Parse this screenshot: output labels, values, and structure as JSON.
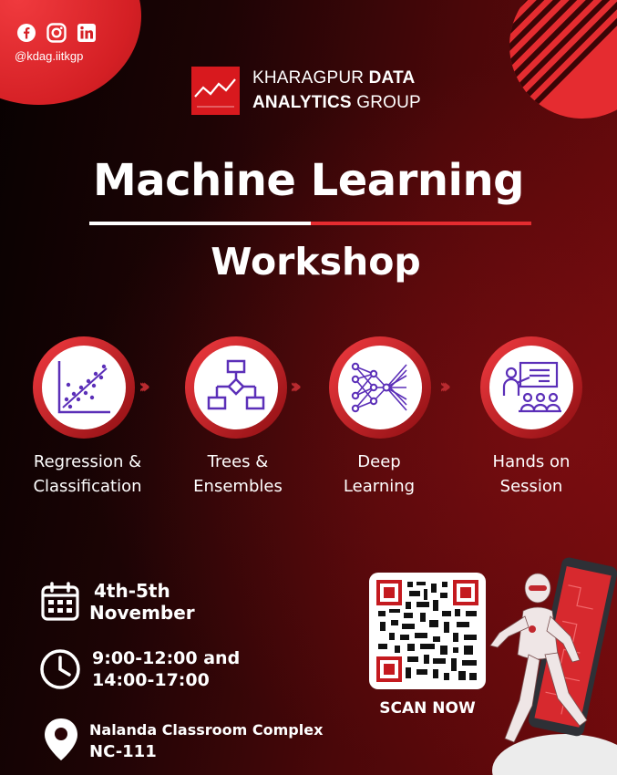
{
  "social": {
    "icons": [
      "facebook-icon",
      "instagram-icon",
      "linkedin-icon"
    ],
    "handle": "@kdag.iitkgp"
  },
  "logo": {
    "line1_light": "KHARAGPUR ",
    "line1_bold": "DATA",
    "line2_bold": "ANALYTICS",
    "line2_light": " GROUP"
  },
  "title": "Machine Learning",
  "subtitle": "Workshop",
  "steps": [
    {
      "icon": "scatter-plot-icon",
      "line1": "Regression &",
      "line2": "Classification"
    },
    {
      "icon": "flowchart-tree-icon",
      "line1": "Trees &",
      "line2": "Ensembles"
    },
    {
      "icon": "neural-network-icon",
      "line1": "Deep",
      "line2": "Learning"
    },
    {
      "icon": "presentation-icon",
      "line1": "Hands on",
      "line2": "Session"
    }
  ],
  "details": {
    "date_line1": "4th-5th",
    "date_line2": "November",
    "time_line1": "9:00-12:00 and",
    "time_line2": "14:00-17:00",
    "venue_line1": "Nalanda Classroom Complex",
    "venue_line2": "NC-111"
  },
  "qr": {
    "label": "SCAN NOW"
  },
  "colors": {
    "accent": "#e52c30",
    "background_dark": "#070101",
    "background_red": "#6e0a0c",
    "icon_purple": "#5b2fb8"
  }
}
